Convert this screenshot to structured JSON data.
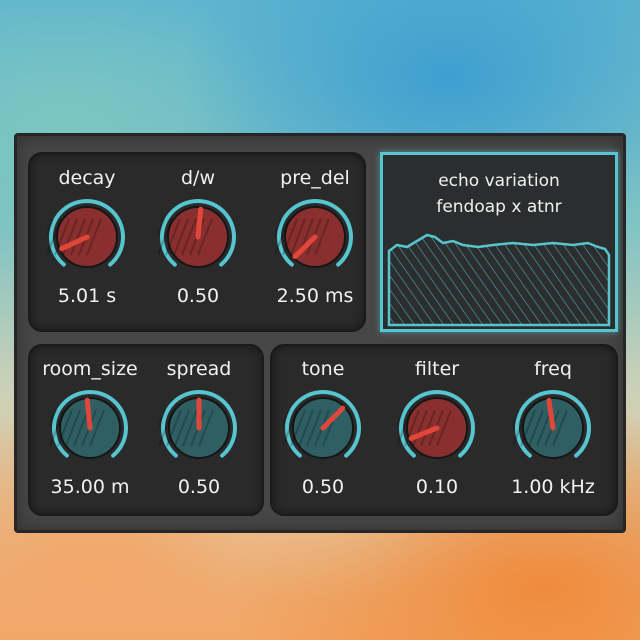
{
  "colors": {
    "accent": "#57c5cf",
    "knob_red": "#8a2f2f",
    "knob_teal": "#2f5f63",
    "pointer": "#e0473a",
    "panel": "#474747",
    "section": "#2a2a2a"
  },
  "display": {
    "title_line1": "echo variation",
    "title_line2": "fendoap x atnr"
  },
  "knobs": [
    {
      "id": "decay",
      "label": "decay",
      "value": "5.01 s",
      "level": 0.09,
      "style": "red"
    },
    {
      "id": "dw",
      "label": "d/w",
      "value": "0.50",
      "level": 0.52,
      "style": "red"
    },
    {
      "id": "pre_del",
      "label": "pre_del",
      "value": "2.50 ms",
      "level": 0.02,
      "style": "red"
    },
    {
      "id": "room_size",
      "label": "room_size",
      "value": "35.00 m",
      "level": 0.48,
      "style": "teal"
    },
    {
      "id": "spread",
      "label": "spread",
      "value": "0.50",
      "level": 0.5,
      "style": "teal"
    },
    {
      "id": "tone",
      "label": "tone",
      "value": "0.50",
      "level": 0.66,
      "style": "teal"
    },
    {
      "id": "filter",
      "label": "filter",
      "value": "0.10",
      "level": 0.1,
      "style": "red"
    },
    {
      "id": "freq",
      "label": "freq",
      "value": "1.00 kHz",
      "level": 0.47,
      "style": "teal"
    }
  ]
}
